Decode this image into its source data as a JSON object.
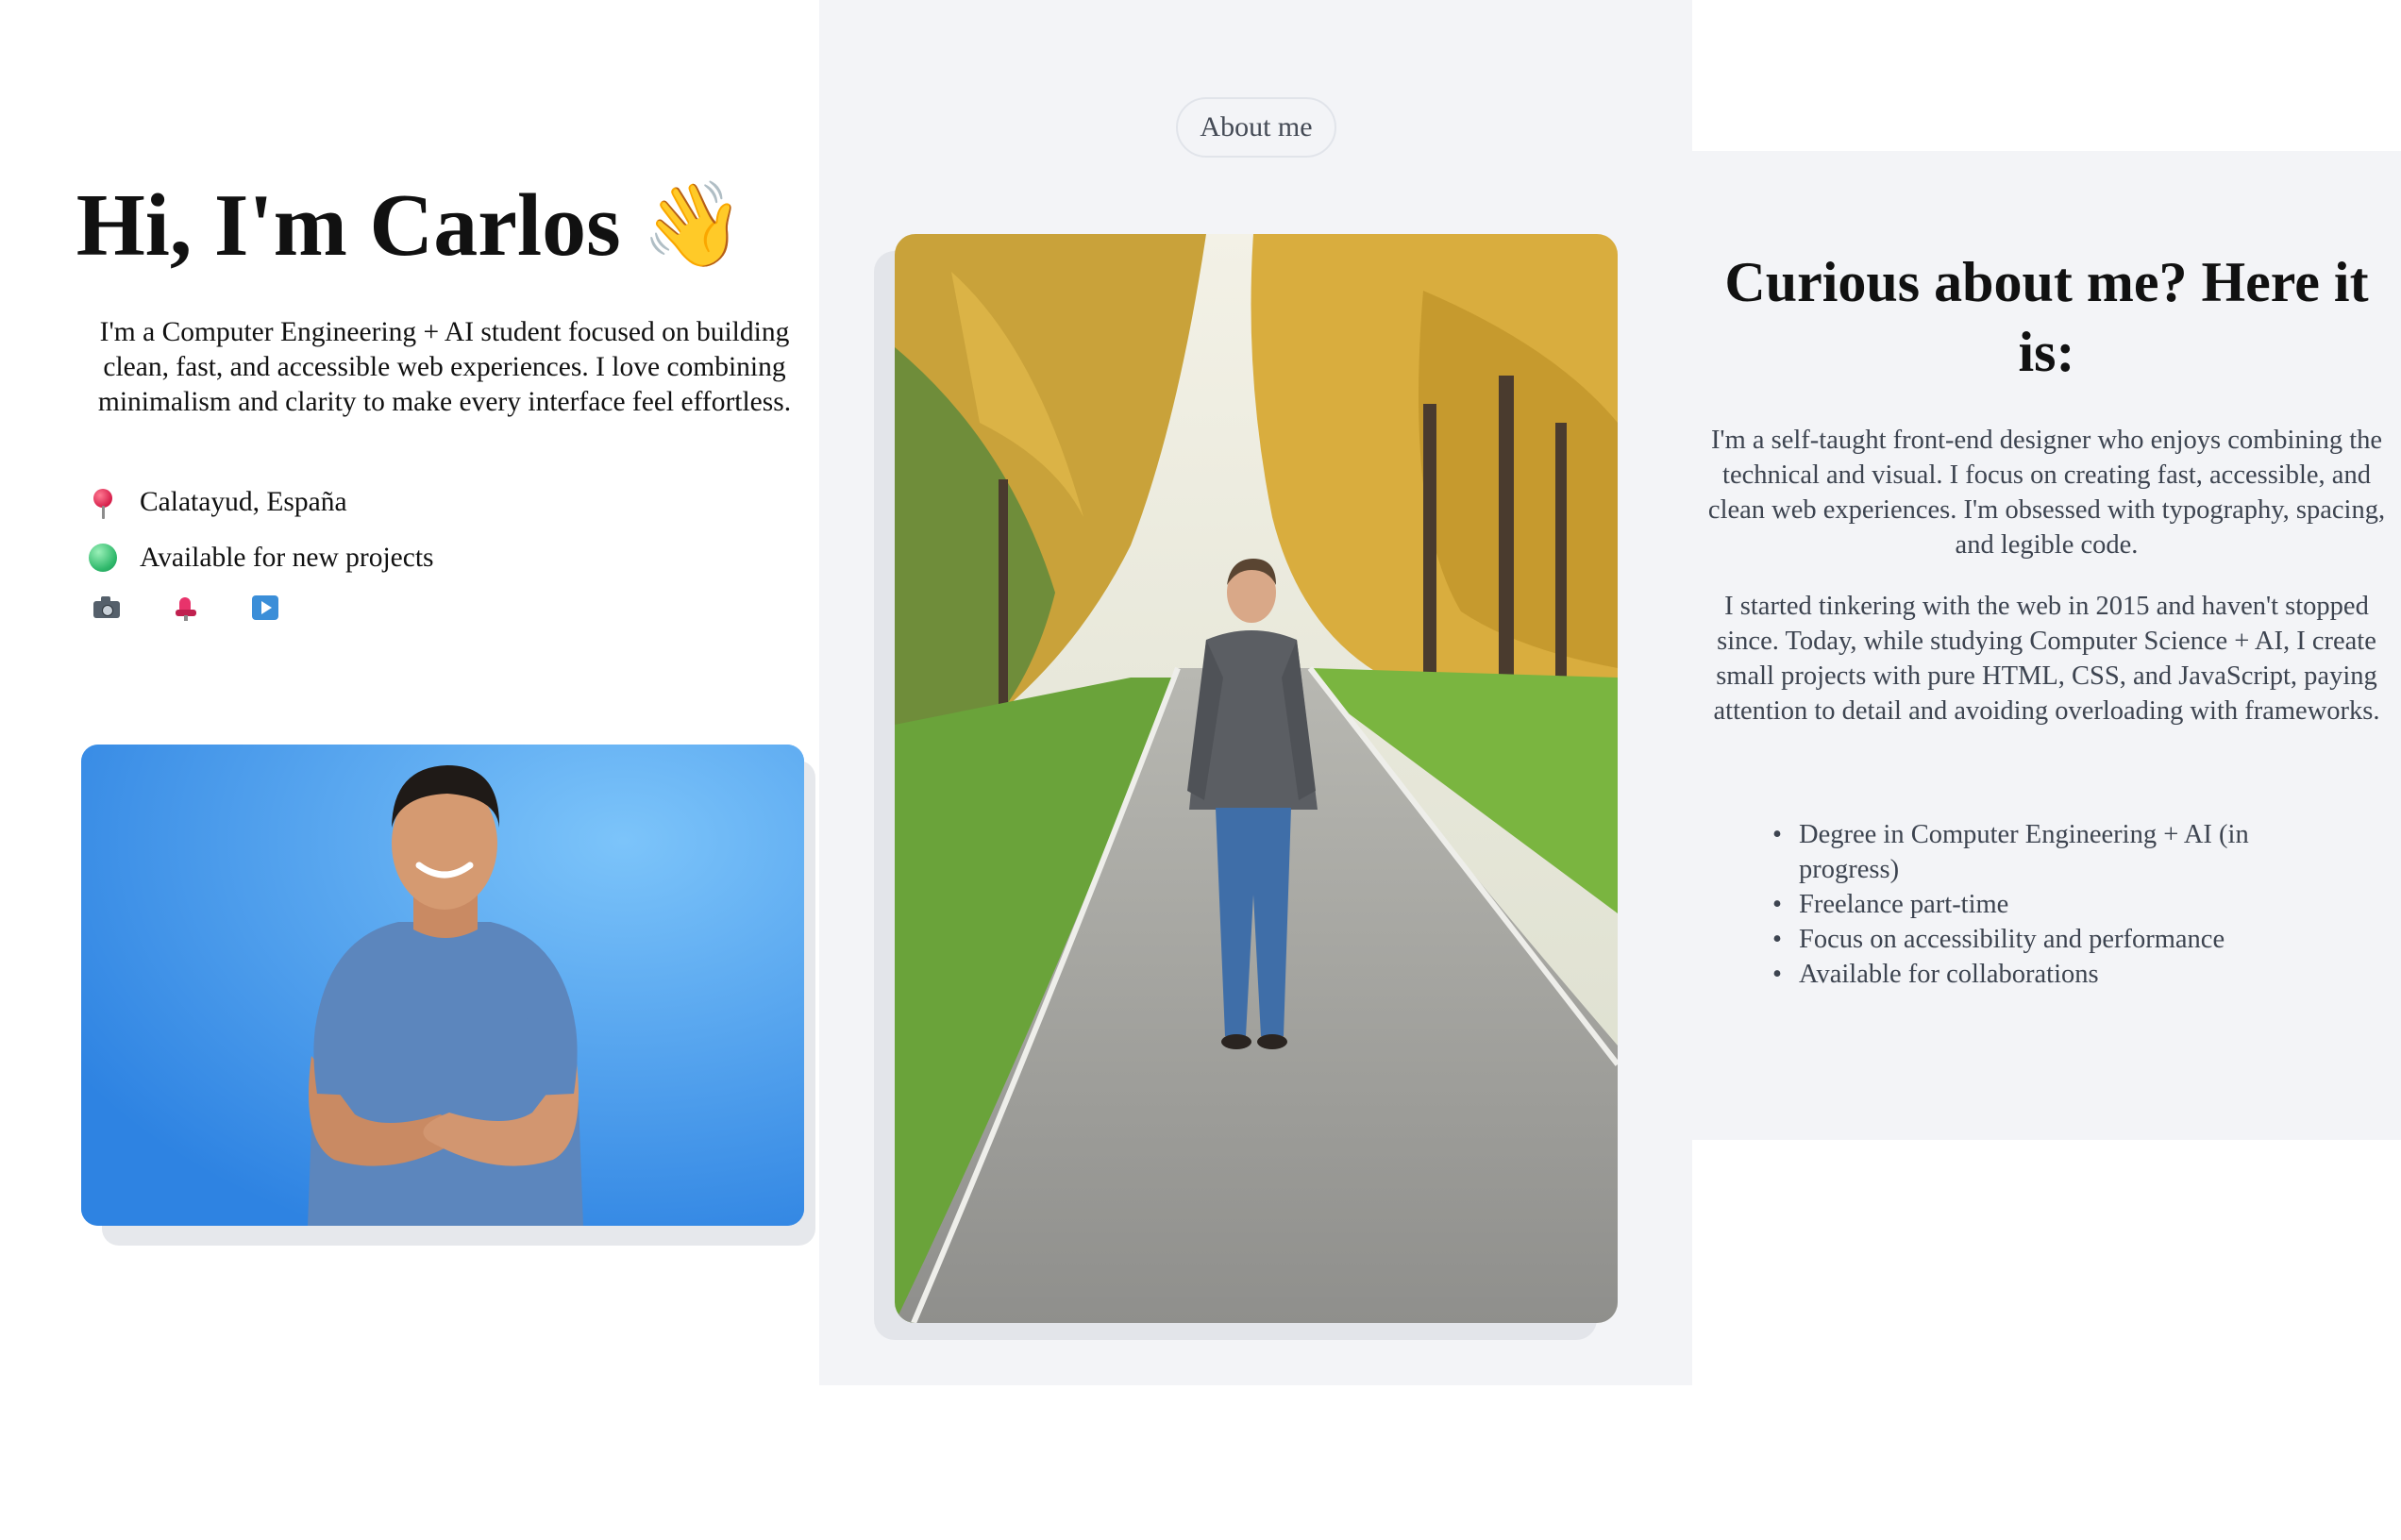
{
  "hero": {
    "title": "Hi, I'm Carlos",
    "wave_emoji": "👋",
    "description": "I'm a Computer Engineering + AI student focused on building clean, fast, and accessible web experiences. I love combining minimalism and clarity to make every interface feel effortless.",
    "location": "Calatayud, España",
    "availability": "Available for new projects",
    "location_icon": "pin-icon",
    "availability_icon": "green-circle-icon",
    "social_icons": [
      "camera-icon",
      "chair-icon",
      "play-icon"
    ]
  },
  "about": {
    "pill_label": "About me",
    "title": "Curious about me? Here it is:",
    "paragraph_1": "I'm a self-taught front-end designer who enjoys combining the technical and visual. I focus on creating fast, accessible, and clean web experiences. I'm obsessed with typography, spacing, and legible code.",
    "paragraph_2": "I started tinkering with the web in 2015 and haven't stopped since. Today, while studying Computer Science + AI, I create small projects with pure HTML, CSS, and JavaScript, paying attention to detail and avoiding overloading with frameworks.",
    "highlights": [
      "Degree in Computer Engineering + AI (in progress)",
      "Freelance part-time",
      "Focus on accessibility and performance",
      "Available for collaborations"
    ]
  },
  "colors": {
    "page_bg": "#ffffff",
    "panel_bg": "#f3f4f7",
    "hero_photo_bg": "#3a95ee",
    "body_text": "#3d4450"
  }
}
